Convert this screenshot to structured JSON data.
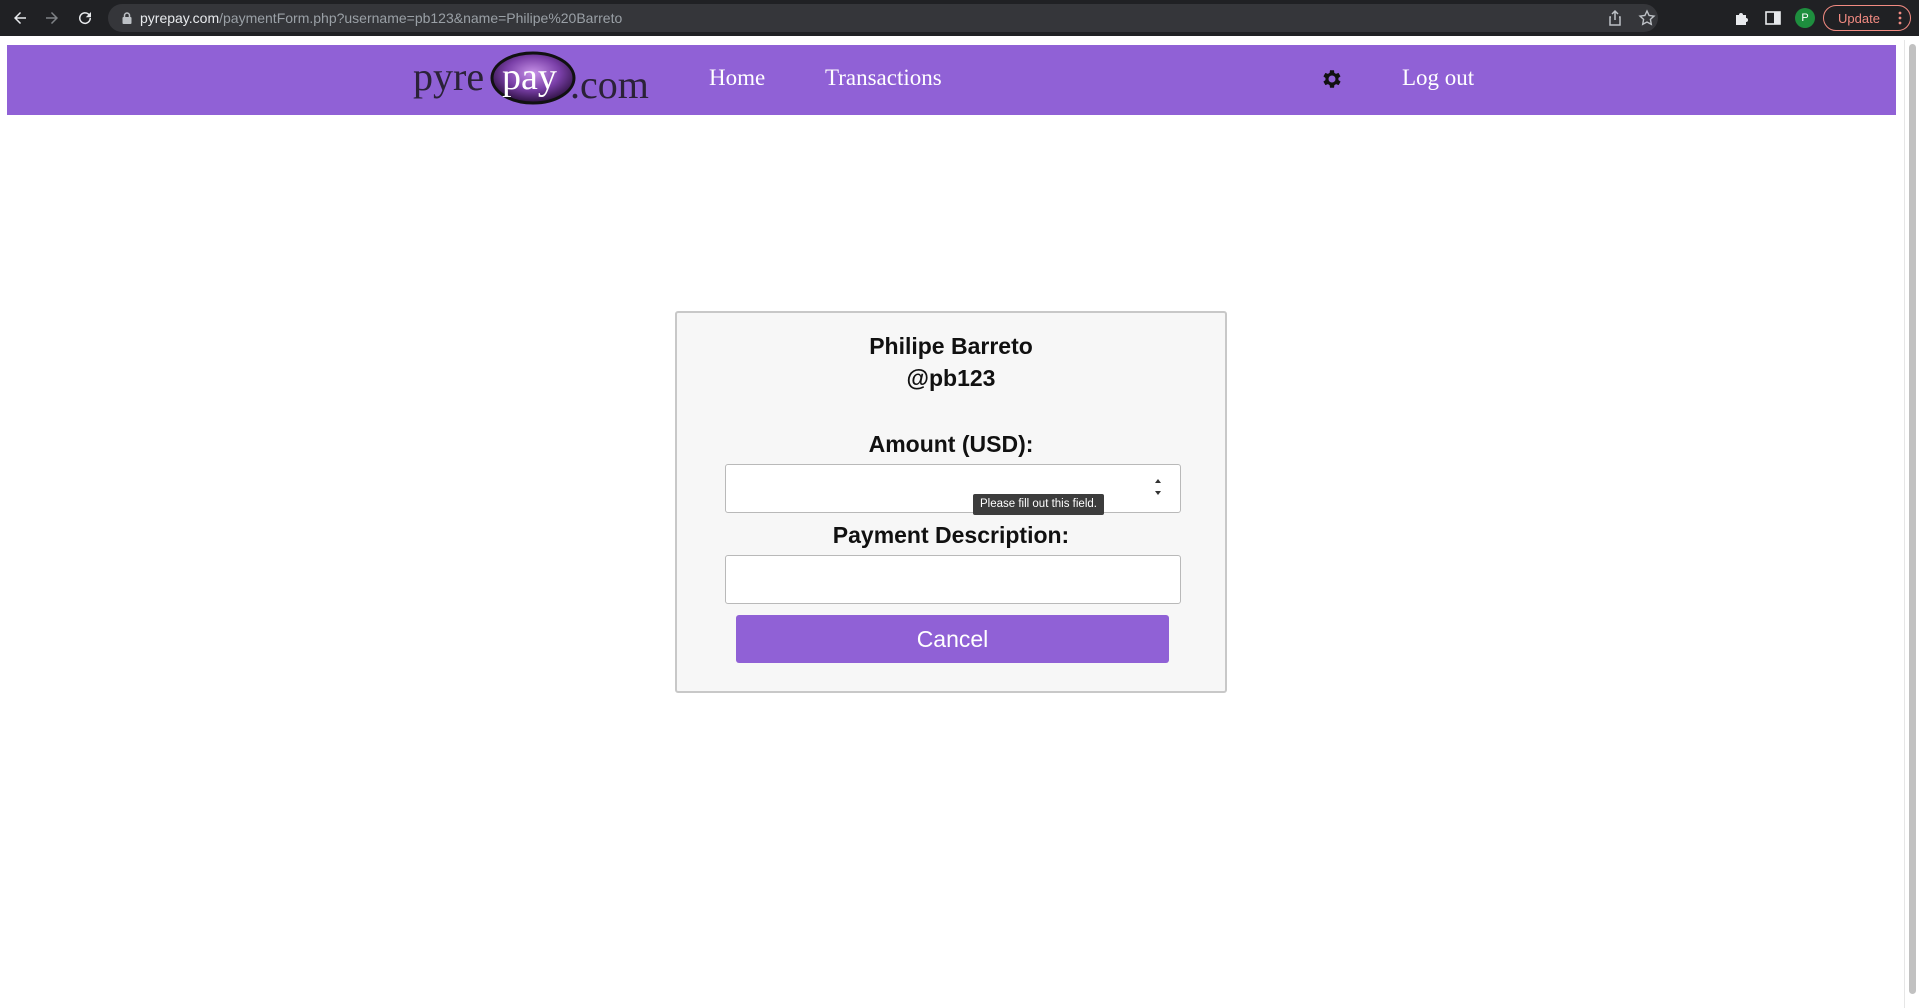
{
  "browser": {
    "url_host": "pyrepay.com",
    "url_path": "/paymentForm.php?username=pb123&name=Philipe%20Barreto",
    "profile_initial": "P",
    "update_label": "Update"
  },
  "header": {
    "logo_text_left": "pyre",
    "logo_text_pay": "pay",
    "logo_text_right": ".com",
    "nav_home": "Home",
    "nav_transactions": "Transactions",
    "nav_logout": "Log out"
  },
  "form": {
    "payee_name": "Philipe Barreto",
    "payee_handle": "@pb123",
    "amount_label": "Amount (USD):",
    "amount_value": "",
    "description_label": "Payment Description:",
    "description_value": "",
    "validation_tooltip": "Please fill out this field.",
    "cancel_label": "Cancel"
  },
  "colors": {
    "brand_purple": "#9061d6",
    "chrome_dark": "#202124",
    "update_accent": "#f28b82"
  }
}
